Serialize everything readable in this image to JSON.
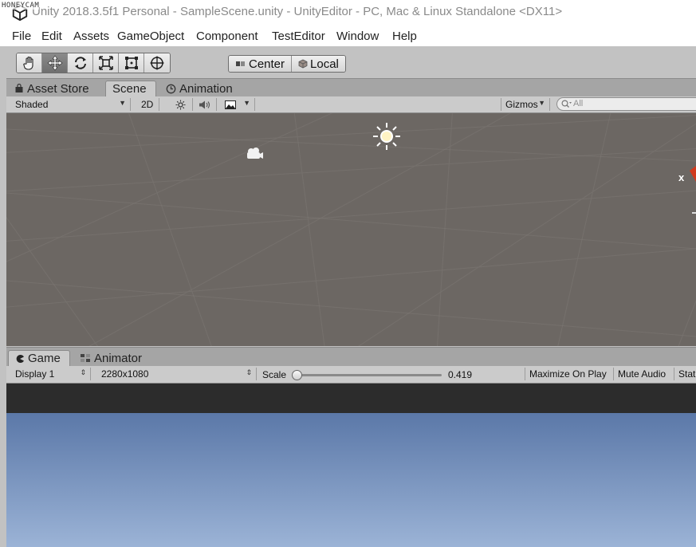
{
  "watermark": "HONEYCAM",
  "window": {
    "title": "Unity 2018.3.5f1 Personal - SampleScene.unity - UnityEditor - PC, Mac & Linux Standalone <DX11>"
  },
  "menu": {
    "items": [
      "File",
      "Edit",
      "Assets",
      "GameObject",
      "Component",
      "TestEditor",
      "Window",
      "Help"
    ]
  },
  "toolbar": {
    "tools": [
      "hand-tool",
      "move-tool",
      "rotate-tool",
      "scale-tool",
      "rect-tool",
      "transform-tool"
    ],
    "active_tool": "move-tool",
    "pivot_label": "Center",
    "space_label": "Local"
  },
  "scene_tabs": {
    "asset_store": "Asset Store",
    "scene": "Scene",
    "animation": "Animation"
  },
  "scene_toolbar": {
    "shading_mode": "Shaded",
    "mode_2d": "2D",
    "gizmos_label": "Gizmos",
    "search_placeholder": "All"
  },
  "scene_view": {
    "gizmo_axis_label": "x"
  },
  "game_tabs": {
    "game": "Game",
    "animator": "Animator"
  },
  "game_toolbar": {
    "display": "Display 1",
    "resolution": "2280x1080",
    "scale_label": "Scale",
    "scale_value": "0.419",
    "maximize_on_play": "Maximize On Play",
    "mute_audio": "Mute Audio",
    "stats": "Stat"
  },
  "colors": {
    "scene_background": "#6c6763",
    "game_sky_top": "#5b78a8",
    "game_sky_bottom": "#9bb3d6",
    "game_letterbox": "#2c2c2c"
  }
}
